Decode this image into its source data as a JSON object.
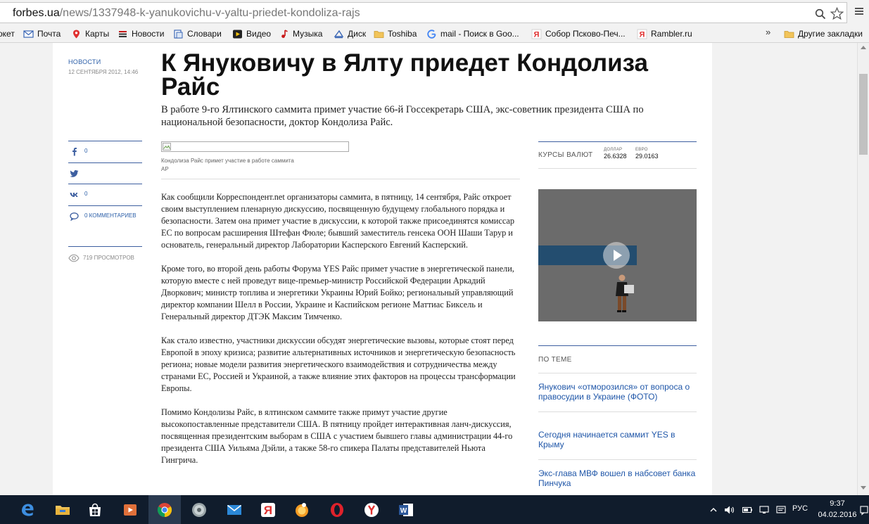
{
  "browser": {
    "url_host": "forbes.ua",
    "url_path": "/news/1337948-k-yanukovichu-v-yaltu-priedet-kondoliza-rajs"
  },
  "bookmarks": {
    "items": [
      {
        "label": "окет"
      },
      {
        "label": "Почта"
      },
      {
        "label": "Карты"
      },
      {
        "label": "Новости"
      },
      {
        "label": "Словари"
      },
      {
        "label": "Видео"
      },
      {
        "label": "Музыка"
      },
      {
        "label": "Диск"
      },
      {
        "label": "Toshiba"
      },
      {
        "label": "mail - Поиск в Goo..."
      },
      {
        "label": "Собор Псково-Печ..."
      },
      {
        "label": "Rambler.ru"
      }
    ],
    "more": "»",
    "other": "Другие закладки"
  },
  "article": {
    "section": "НОВОСТИ",
    "date": "12 СЕНТЯБРЯ 2012, 14:46",
    "title": "К Януковичу в Ялту приедет Кондолиза Райс",
    "lead": "В работе 9-го Ялтинского саммита примет участие 66-й Госсекретарь США, экс-советник президента США по национальной безопасности, доктор Кондолиза Райс.",
    "photo_caption": "Кондолиза Райс примет участие в работе саммита",
    "photo_credit": "AP",
    "paragraphs": [
      "Как сообщили Корреспондент.net организаторы саммита, в пятницу, 14 сентября, Райс откроет своим выступлением пленарную дискуссию, посвященную будущему глобального порядка и безопасности. Затем она примет участие в дискуссии, к которой также присоединятся комиссар ЕС по вопросам расширения Штефан Фюле; бывший заместитель генсека ООН  Шаши Тарур и основатель, генеральный директор Лаборатории Касперского Евгений Касперский.",
      "Кроме того, во второй день работы Форума YES Райс примет участие в энергетической панели, которую вместе с ней проведут вице-премьер-министр Российской Федерации Аркадий Дворкович; министр топлива и энергетики Украины Юрий Бойко; региональный управляющий директор компании Шелл в России, Украине и Каспийском регионе Маттиас Биксель и Генеральный директор ДТЭК Максим Тимченко.",
      "Как стало известно, участники дискуссии обсудят энергетические вызовы, которые стоят перед Европой в эпоху кризиса; развитие альтернативных источников и энергетическую безопасность региона; новые модели развития энергетического взаимодействия и сотрудничества между странами ЕС, Россией и Украиной, а также влияние этих факторов на процессы трансформации Европы.",
      "Помимо Кондолизы Райс, в ялтинском саммите также примут участие другие высокопоставленные представители США. В пятницу пройдет интерактивная ланч-дискуссия, посвященная президентским выборам в США с участием бывшего главы администрации 44-го президента США Уильяма Дэйли, а также 58-го спикера Палаты представителей Ньюта Гингрича."
    ]
  },
  "share": {
    "facebook_count": "0",
    "vk_count": "0",
    "comments": "0 КОММЕНТАРИЕВ",
    "views": "719 ПРОСМОТРОВ"
  },
  "rates": {
    "label": "КУРСЫ ВАЛЮТ",
    "dollar_label": "ДОЛЛАР",
    "dollar_value": "26.6328",
    "euro_label": "ЕВРО",
    "euro_value": "29.0163"
  },
  "related": {
    "title": "ПО ТЕМЕ",
    "items": [
      "Янукович «отморозился» от вопроса о правосудии в Украине (ФОТО)",
      "Сегодня начинается саммит YES в Крыму",
      "Экс-глава МВФ вошел в набсовет банка Пинчука"
    ]
  },
  "taskbar": {
    "lang": "РУС",
    "time": "9:37",
    "date": "04.02.2016"
  },
  "colors": {
    "link": "#1f56a8",
    "rule": "#3d5fa0",
    "taskbar": "#101c2c"
  }
}
